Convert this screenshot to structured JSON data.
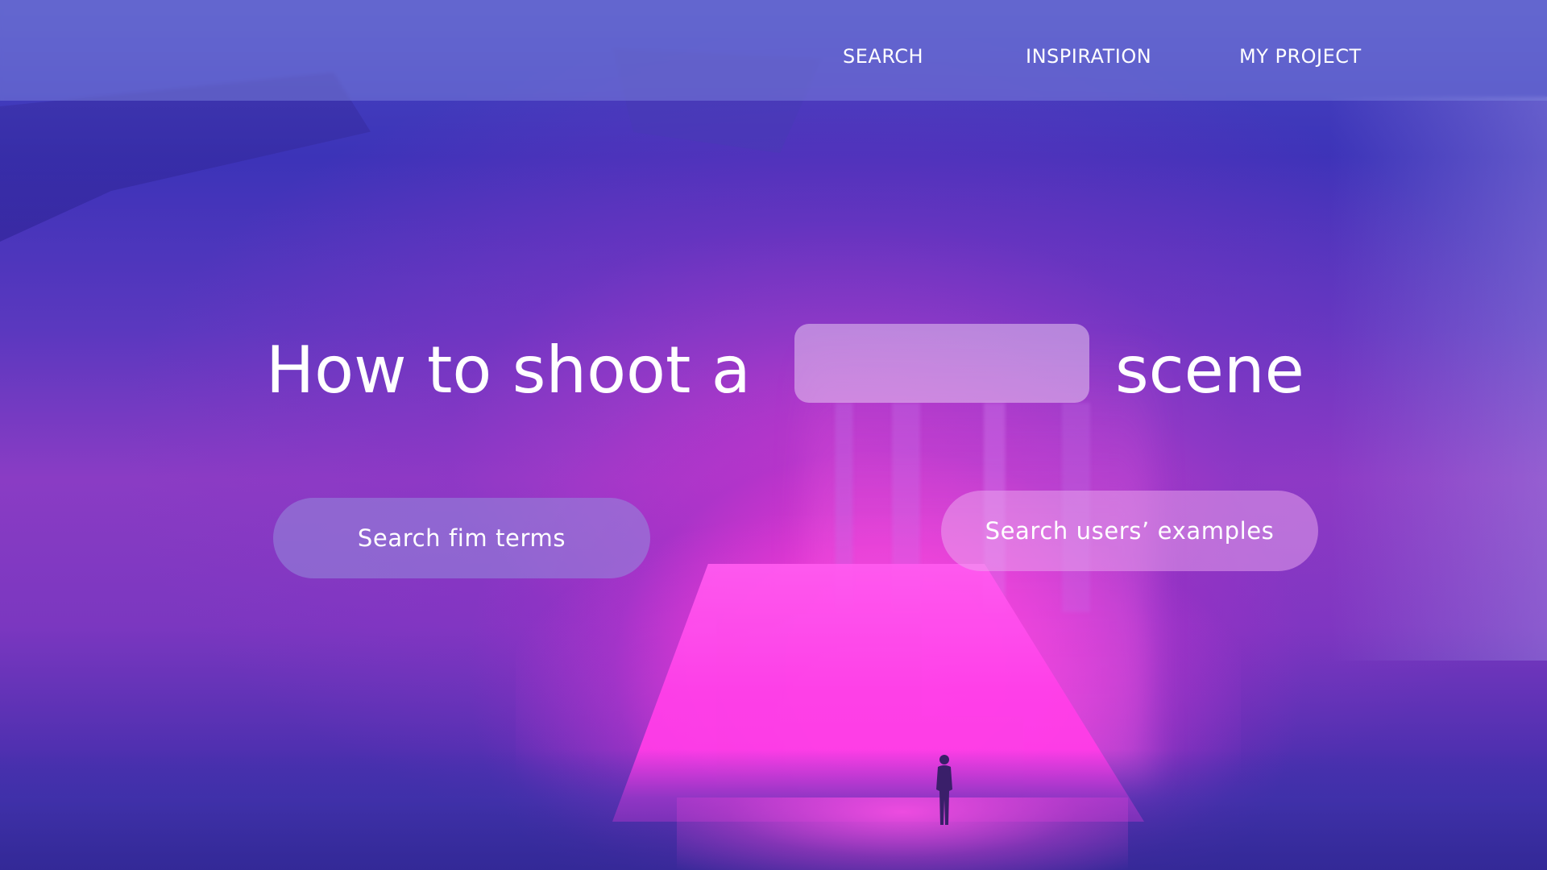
{
  "nav": {
    "items": [
      {
        "label": "SEARCH"
      },
      {
        "label": "INSPIRATION"
      },
      {
        "label": "MY PROJECT"
      }
    ]
  },
  "hero": {
    "prefix": "How to shoot a",
    "scene_input_value": "",
    "scene_input_placeholder": "",
    "suffix": "scene"
  },
  "actions": {
    "film_terms_label": "Search fim terms",
    "users_examples_label": "Search users’ examples"
  },
  "colors": {
    "accent_magenta": "#ff40e8",
    "background_indigo": "#3c33b8",
    "text": "#ffffff"
  }
}
